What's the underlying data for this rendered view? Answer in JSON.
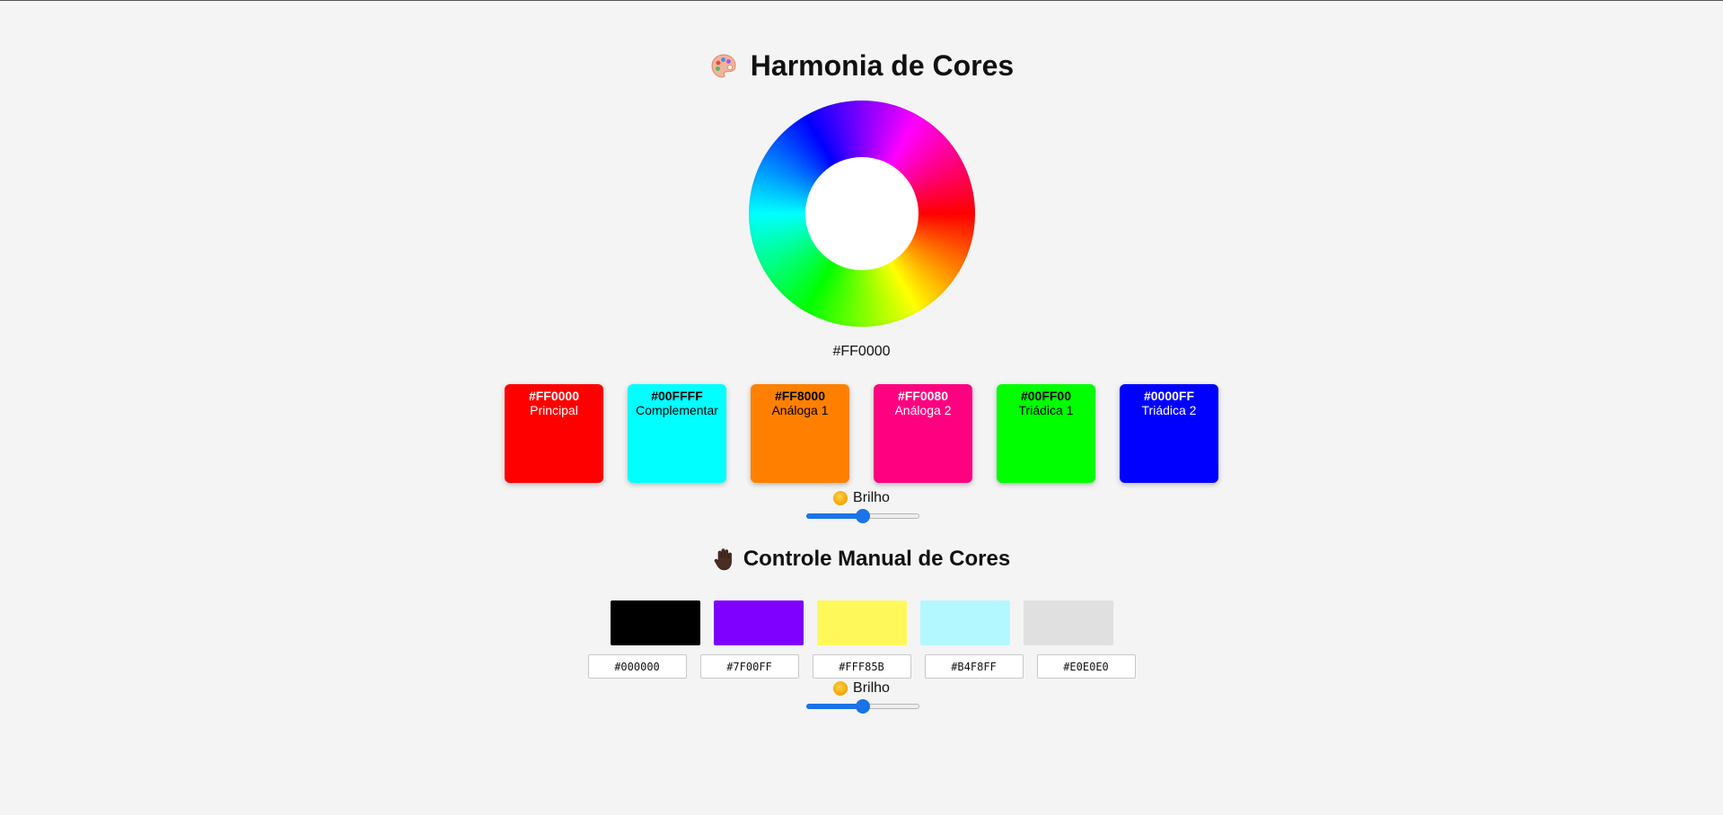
{
  "header": {
    "title": "Harmonia de Cores",
    "icon": "palette-icon"
  },
  "wheel": {
    "selected_hex": "#FF0000"
  },
  "harmony": {
    "swatches": [
      {
        "hex": "#FF0000",
        "label": "Principal",
        "color": "#FF0000",
        "text_color": "#ffffff"
      },
      {
        "hex": "#00FFFF",
        "label": "Complementar",
        "color": "#00FFFF",
        "text_color": "#000000"
      },
      {
        "hex": "#FF8000",
        "label": "Análoga 1",
        "color": "#FF8000",
        "text_color": "#000000"
      },
      {
        "hex": "#FF0080",
        "label": "Análoga 2",
        "color": "#FF0080",
        "text_color": "#ffffff"
      },
      {
        "hex": "#00FF00",
        "label": "Triádica 1",
        "color": "#00FF00",
        "text_color": "#000000"
      },
      {
        "hex": "#0000FF",
        "label": "Triádica 2",
        "color": "#0000FF",
        "text_color": "#ffffff"
      }
    ],
    "brightness_label": "Brilho",
    "brightness_value": 0.5
  },
  "manual": {
    "title": "Controle Manual de Cores",
    "icon": "raised-hand-icon",
    "colors": [
      "#000000",
      "#7F00FF",
      "#FFF85B",
      "#B4F8FF",
      "#E0E0E0"
    ],
    "brightness_label": "Brilho",
    "brightness_value": 0.5
  }
}
